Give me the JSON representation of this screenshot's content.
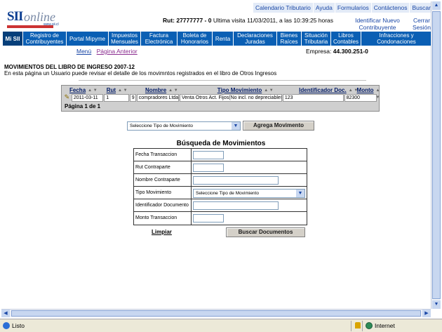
{
  "logo": {
    "sii": "SII",
    "online": "online",
    "www": "www.sii.cl"
  },
  "top_links": [
    "Calendario Tributario",
    "Ayuda",
    "Formularios",
    "Contáctenos",
    "Buscar"
  ],
  "rut_line": {
    "rut": "Rut: 27777777 - 0",
    "visit": "Ultima visita 11/03/2011, a las 10:39:25 horas"
  },
  "identificar": {
    "line1": "Identificar Nuevo",
    "line2": "Contribuyente"
  },
  "cerrar": {
    "line1": "Cerrar",
    "line2": "Sesión"
  },
  "nav": [
    {
      "l1": "Mi SII",
      "l2": ""
    },
    {
      "l1": "Registro de",
      "l2": "Contribuyentes"
    },
    {
      "l1": "Portal Mipyme",
      "l2": ""
    },
    {
      "l1": "Impuestos",
      "l2": "Mensuales"
    },
    {
      "l1": "Factura",
      "l2": "Electrónica"
    },
    {
      "l1": "Boleta de",
      "l2": "Honorarios"
    },
    {
      "l1": "Renta",
      "l2": ""
    },
    {
      "l1": "Declaraciones",
      "l2": "Juradas"
    },
    {
      "l1": "Bienes",
      "l2": "Raíces"
    },
    {
      "l1": "Situación",
      "l2": "Tributaria"
    },
    {
      "l1": "Libros",
      "l2": "Contables"
    },
    {
      "l1": "Infracciones y",
      "l2": "Condonaciones"
    }
  ],
  "sublinks": {
    "menu": "Menú",
    "back": "Página Anterior"
  },
  "empresa": {
    "label": "Empresa:",
    "value": "44.300.251-0"
  },
  "page": {
    "title": "MOVIMIENTOS DEL LIBRO DE INGRESO 2007-12",
    "description": "En esta página un Usuario puede revisar el detalle de los movimntos registrados en el libro de Otros Ingresos"
  },
  "table": {
    "headers": [
      "Fecha",
      "Rut",
      "Nombre",
      "Tipo Movimiento",
      "Identificador Doc.",
      "Monto"
    ],
    "rows": [
      [
        "2011-03-11",
        "1",
        "9",
        "compradores Ltda",
        "Venta Otros Act. Fijos(No incl. no depreciables)",
        "123",
        "82300"
      ]
    ],
    "pager": "Página 1 de 1"
  },
  "add_movement": {
    "select_value": "Seleccione Tipo de Movimiento",
    "button": "Agrega Movimento"
  },
  "search": {
    "title": "Búsqueda de Movimientos",
    "fields": [
      {
        "label": "Fecha Transaccion",
        "value": ""
      },
      {
        "label": "Rut Contraparte",
        "value": ""
      },
      {
        "label": "Nombre Contraparte",
        "value": ""
      },
      {
        "label": "Tipo Movimiento",
        "value": "Seleccione Tipo de Movimiento"
      },
      {
        "label": "Identificador Documento",
        "value": ""
      },
      {
        "label": "Monto Transaccion",
        "value": ""
      }
    ],
    "clear": "Limpiar",
    "submit": "Buscar Documentos"
  },
  "status": {
    "text": "Listo",
    "zone": "Internet"
  },
  "colors": {
    "nav_bg": "#0a5fb4",
    "link": "#1a47a6",
    "grid_bg": "#cfcfcf"
  }
}
